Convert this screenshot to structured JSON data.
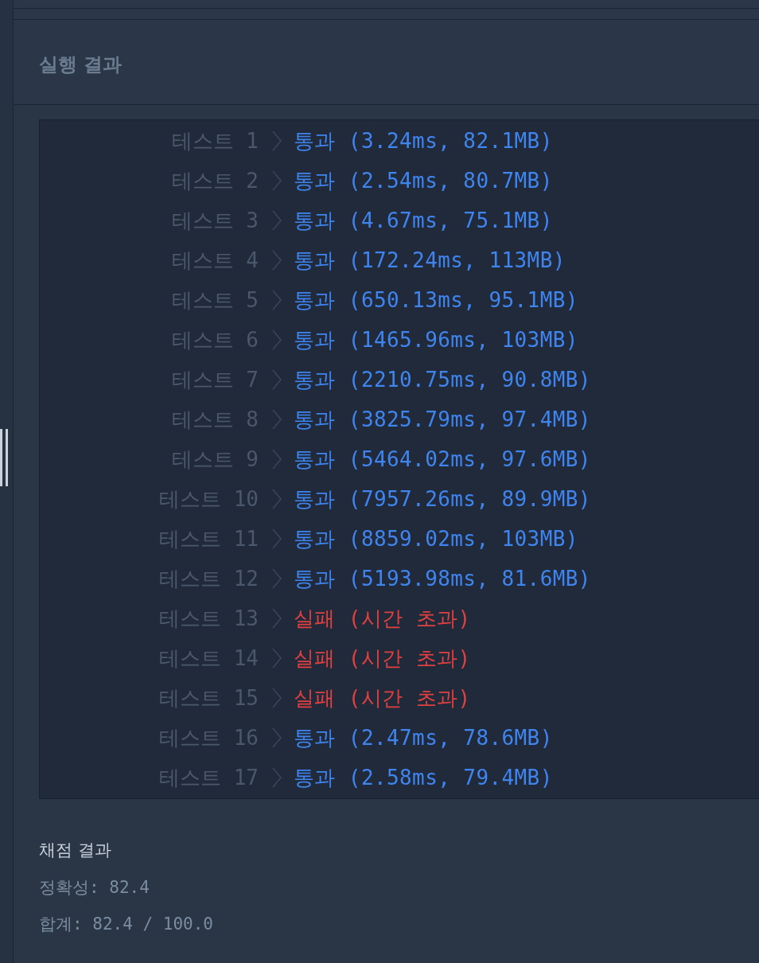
{
  "run_result": {
    "title": "실행 결과",
    "tests": [
      {
        "label": "테스트 1",
        "kind": "pass",
        "result": "통과 (3.24ms, 82.1MB)"
      },
      {
        "label": "테스트 2",
        "kind": "pass",
        "result": "통과 (2.54ms, 80.7MB)"
      },
      {
        "label": "테스트 3",
        "kind": "pass",
        "result": "통과 (4.67ms, 75.1MB)"
      },
      {
        "label": "테스트 4",
        "kind": "pass",
        "result": "통과 (172.24ms, 113MB)"
      },
      {
        "label": "테스트 5",
        "kind": "pass",
        "result": "통과 (650.13ms, 95.1MB)"
      },
      {
        "label": "테스트 6",
        "kind": "pass",
        "result": "통과 (1465.96ms, 103MB)"
      },
      {
        "label": "테스트 7",
        "kind": "pass",
        "result": "통과 (2210.75ms, 90.8MB)"
      },
      {
        "label": "테스트 8",
        "kind": "pass",
        "result": "통과 (3825.79ms, 97.4MB)"
      },
      {
        "label": "테스트 9",
        "kind": "pass",
        "result": "통과 (5464.02ms, 97.6MB)"
      },
      {
        "label": "테스트 10",
        "kind": "pass",
        "result": "통과 (7957.26ms, 89.9MB)"
      },
      {
        "label": "테스트 11",
        "kind": "pass",
        "result": "통과 (8859.02ms, 103MB)"
      },
      {
        "label": "테스트 12",
        "kind": "pass",
        "result": "통과 (5193.98ms, 81.6MB)"
      },
      {
        "label": "테스트 13",
        "kind": "fail",
        "result": "실패 (시간 초과)"
      },
      {
        "label": "테스트 14",
        "kind": "fail",
        "result": "실패 (시간 초과)"
      },
      {
        "label": "테스트 15",
        "kind": "fail",
        "result": "실패 (시간 초과)"
      },
      {
        "label": "테스트 16",
        "kind": "pass",
        "result": "통과 (2.47ms, 78.6MB)"
      },
      {
        "label": "테스트 17",
        "kind": "pass",
        "result": "통과 (2.58ms, 79.4MB)"
      }
    ]
  },
  "grading": {
    "title": "채점 결과",
    "accuracy": "정확성: 82.4",
    "total": "합계: 82.4 / 100.0"
  }
}
